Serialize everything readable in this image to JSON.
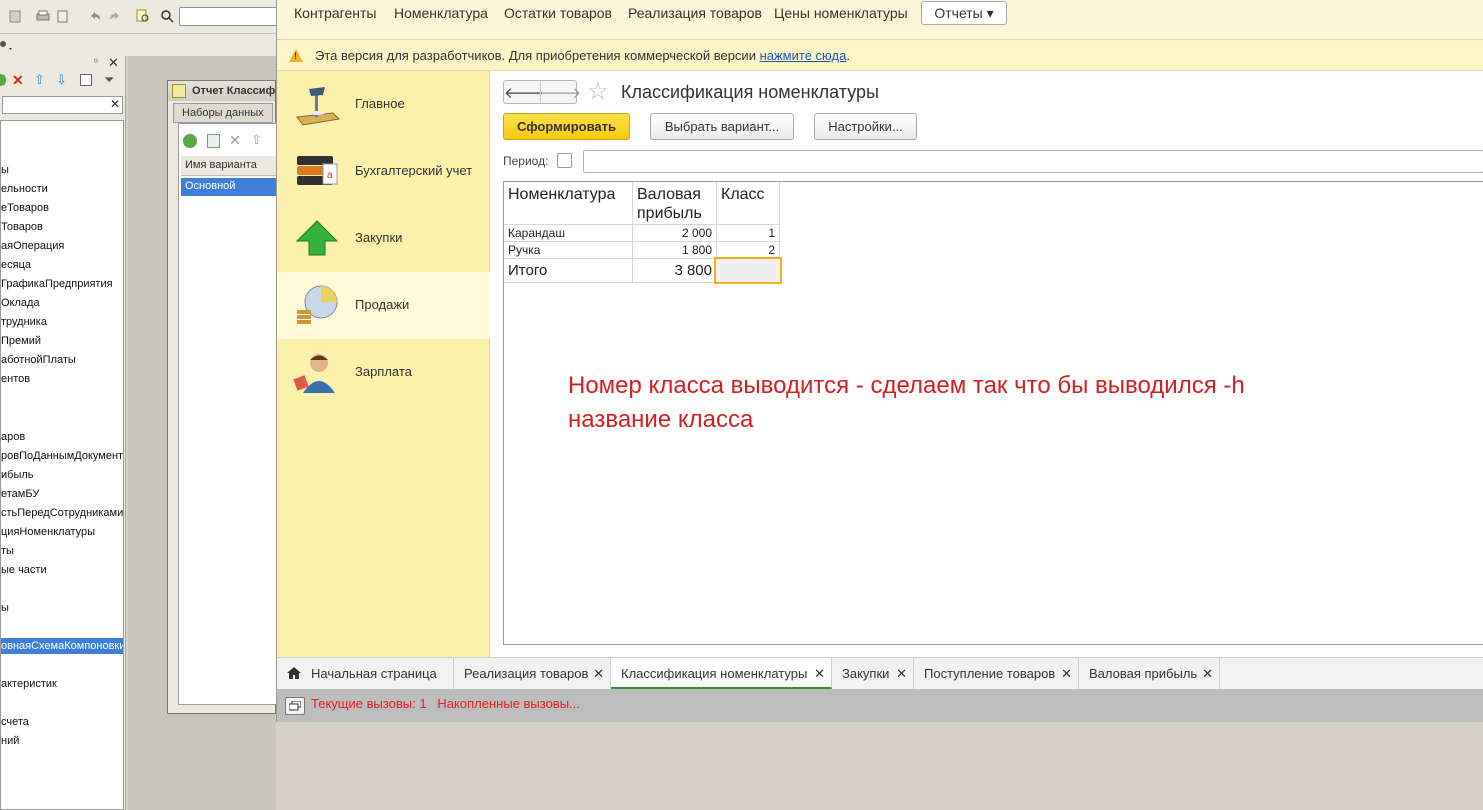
{
  "ide": {
    "tree_items": [
      "ы",
      "ельности",
      "еТоваров",
      "Товаров",
      "аяОперация",
      "есяца",
      "ГрафикаПредприятия",
      "Оклада",
      "трудника",
      "Премий",
      "аботнойПлаты",
      "ентов",
      "аров",
      "ровПоДаннымДокумент",
      "ибыль",
      "етамБУ",
      "стьПередСотрудниками",
      "цияНоменклатуры",
      "ты",
      "ые части",
      "ы",
      "овнаяСхемаКомпоновки",
      "актеристик",
      "счета",
      "ний"
    ],
    "window_title": "Отчет Классиф",
    "window_tab": "Наборы данных",
    "variant_column": "Имя варианта",
    "variant_row": "Основной"
  },
  "topnav": {
    "items": [
      "Контрагенты",
      "Номенклатура",
      "Остатки товаров",
      "Реализация товаров",
      "Цены номенклатуры"
    ],
    "reports_label": "Отчеты ▾"
  },
  "warning": {
    "text": "Эта версия для разработчиков. Для приобретения коммерческой версии ",
    "link": "нажмите сюда",
    "tail": "."
  },
  "sections": [
    {
      "label": "Главное",
      "icon": "desk-lamp-icon"
    },
    {
      "label": "Бухгалтерский учет",
      "icon": "binders-icon"
    },
    {
      "label": "Закупки",
      "icon": "green-arrow-up-icon"
    },
    {
      "label": "Продажи",
      "icon": "pie-coins-icon"
    },
    {
      "label": "Зарплата",
      "icon": "person-icon"
    }
  ],
  "form": {
    "title": "Классификация номенклатуры",
    "generate_button": "Сформировать",
    "choose_variant_button": "Выбрать вариант...",
    "settings_button": "Настройки...",
    "period_label": "Период:"
  },
  "report": {
    "headers": [
      "Номенклатура",
      "Валовая\nприбыль",
      "Класс"
    ],
    "rows": [
      {
        "name": "Карандаш",
        "profit": "2 000",
        "class": "1"
      },
      {
        "name": "Ручка",
        "profit": "1 800",
        "class": "2"
      }
    ],
    "total_label": "Итого",
    "total_value": "3 800"
  },
  "annotation": "Номер класса выводится - сделаем так что бы выводился -h название класса",
  "tabs": [
    {
      "label": "Начальная страница",
      "closable": false
    },
    {
      "label": "Реализация товаров",
      "closable": true
    },
    {
      "label": "Классификация номенклатуры",
      "closable": true,
      "active": true
    },
    {
      "label": "Закупки",
      "closable": true
    },
    {
      "label": "Поступление товаров",
      "closable": true
    },
    {
      "label": "Валовая прибыль",
      "closable": true
    }
  ],
  "status": {
    "current_calls": "Текущие вызовы: 1",
    "accumulated_calls": "Накопленные вызовы..."
  }
}
